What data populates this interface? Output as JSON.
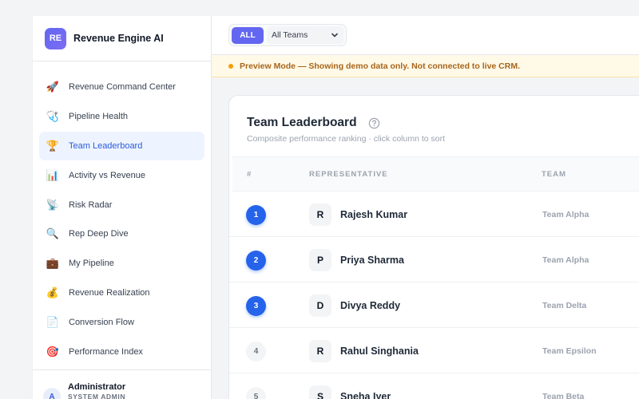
{
  "brand": {
    "logo": "RE",
    "name": "Revenue Engine AI"
  },
  "nav": [
    {
      "label": "Revenue Command Center",
      "icon": "rocket-icon",
      "glyph": "🚀"
    },
    {
      "label": "Pipeline Health",
      "icon": "pipeline-health-icon",
      "glyph": "🩺"
    },
    {
      "label": "Team Leaderboard",
      "icon": "trophy-icon",
      "glyph": "🏆",
      "active": true
    },
    {
      "label": "Activity vs Revenue",
      "icon": "bar-chart-icon",
      "glyph": "📊"
    },
    {
      "label": "Risk Radar",
      "icon": "radar-icon",
      "glyph": "📡"
    },
    {
      "label": "Rep Deep Dive",
      "icon": "magnifier-icon",
      "glyph": "🔍"
    },
    {
      "label": "My Pipeline",
      "icon": "briefcase-icon",
      "glyph": "💼"
    },
    {
      "label": "Revenue Realization",
      "icon": "money-bag-icon",
      "glyph": "💰"
    },
    {
      "label": "Conversion Flow",
      "icon": "document-icon",
      "glyph": "📄"
    },
    {
      "label": "Performance Index",
      "icon": "target-icon",
      "glyph": "🎯"
    }
  ],
  "user": {
    "initial": "A",
    "name": "Administrator",
    "role": "SYSTEM ADMIN"
  },
  "topbar": {
    "all_label": "ALL",
    "team_select": "All Teams"
  },
  "banner": {
    "text": "Preview Mode — Showing demo data only. Not connected to live CRM."
  },
  "card": {
    "title": "Team Leaderboard",
    "subtitle": "Composite performance ranking · click column to sort",
    "columns": {
      "rank": "#",
      "rep": "REPRESENTATIVE",
      "team": "TEAM"
    },
    "rows": [
      {
        "rank": "1",
        "initial": "R",
        "name": "Rajesh Kumar",
        "team": "Team Alpha",
        "top": true
      },
      {
        "rank": "2",
        "initial": "P",
        "name": "Priya Sharma",
        "team": "Team Alpha",
        "top": true
      },
      {
        "rank": "3",
        "initial": "D",
        "name": "Divya Reddy",
        "team": "Team Delta",
        "top": true
      },
      {
        "rank": "4",
        "initial": "R",
        "name": "Rahul Singhania",
        "team": "Team Epsilon",
        "top": false
      },
      {
        "rank": "5",
        "initial": "S",
        "name": "Sneha Iyer",
        "team": "Team Beta",
        "top": false
      }
    ]
  },
  "colors": {
    "accent": "#6366f1",
    "rank_top": "#2563eb",
    "banner_bg": "#fff9e8",
    "banner_text": "#a8651a",
    "active_nav_bg": "#eef4ff"
  }
}
